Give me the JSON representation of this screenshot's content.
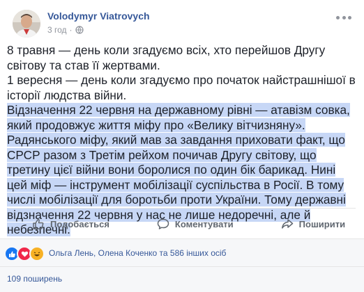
{
  "post": {
    "author": "Volodymyr Viatrovych",
    "timestamp": "3 год",
    "privacy_icon": "globe-icon",
    "paragraphs": [
      "8 травня — день коли згадуємо всіх, хто перейшов Другу світову та став її жертвами.",
      "1 вересня — день коли згадуємо про початок найстрашнішої в історії людства війни."
    ],
    "highlighted_text": "Відзначення 22 червня на державному рівні — атавізм совка, який продовжує життя міфу про «Велику вітчизняну». Радянського міфу, який мав за завдання приховати факт, що СРСР разом з Третім рейхом почичав Другу світову, що третину цієї війни вони боролися по один бік барикад. Нині цей міф — інструмент мобілізації суспільства в Росії. В тому числі мобілізації для боротьби проти України. Тому державні відзначення 22 червня у нас не лише недоречні, але й небезпечні."
  },
  "actions": {
    "like": "Подобається",
    "comment": "Коментувати",
    "share": "Поширити"
  },
  "reactions": {
    "icons": [
      "like-icon",
      "love-icon",
      "haha-icon"
    ],
    "summary": "Ольга Лень, Олена Коченко та 586 інших осіб"
  },
  "shares": {
    "label": "109 поширень"
  },
  "colors": {
    "link": "#365899",
    "highlight": "#c7d7f6",
    "muted": "#90949c",
    "action": "#606770",
    "like_blue": "#1877f2",
    "love_red": "#f0284a",
    "haha_yellow": "#f7b125"
  }
}
